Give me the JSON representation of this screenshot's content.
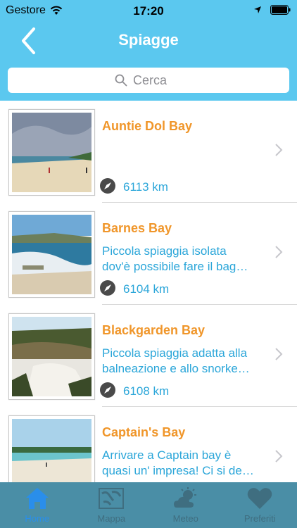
{
  "status_bar": {
    "carrier": "Gestore",
    "time": "17:20"
  },
  "nav": {
    "title": "Spiagge"
  },
  "search": {
    "placeholder": "Cerca"
  },
  "beaches": [
    {
      "name": "Auntie Dol Bay",
      "description": "",
      "distance": "6113 km"
    },
    {
      "name": "Barnes Bay",
      "description": "Piccola spiaggia isolata\ndov'è possibile fare il bag…",
      "distance": "6104 km"
    },
    {
      "name": "Blackgarden Bay",
      "description": "Piccola spiaggia adatta alla\nbalneazione e allo snorke…",
      "distance": "6108 km"
    },
    {
      "name": "Captain's Bay",
      "description": "Arrivare a Captain bay è\nquasi un' impresa! Ci si de…",
      "distance": ""
    }
  ],
  "tabs": [
    {
      "label": "Home",
      "icon": "home-icon",
      "active": true
    },
    {
      "label": "Mappa",
      "icon": "map-icon",
      "active": false
    },
    {
      "label": "Meteo",
      "icon": "weather-icon",
      "active": false
    },
    {
      "label": "Preferiti",
      "icon": "heart-icon",
      "active": false
    }
  ],
  "colors": {
    "accent": "#5bc8ef",
    "title_orange": "#f0962a",
    "text_blue": "#2ba6d9",
    "tabbar": "#4a8ea6",
    "tab_active": "#2a8eea"
  }
}
